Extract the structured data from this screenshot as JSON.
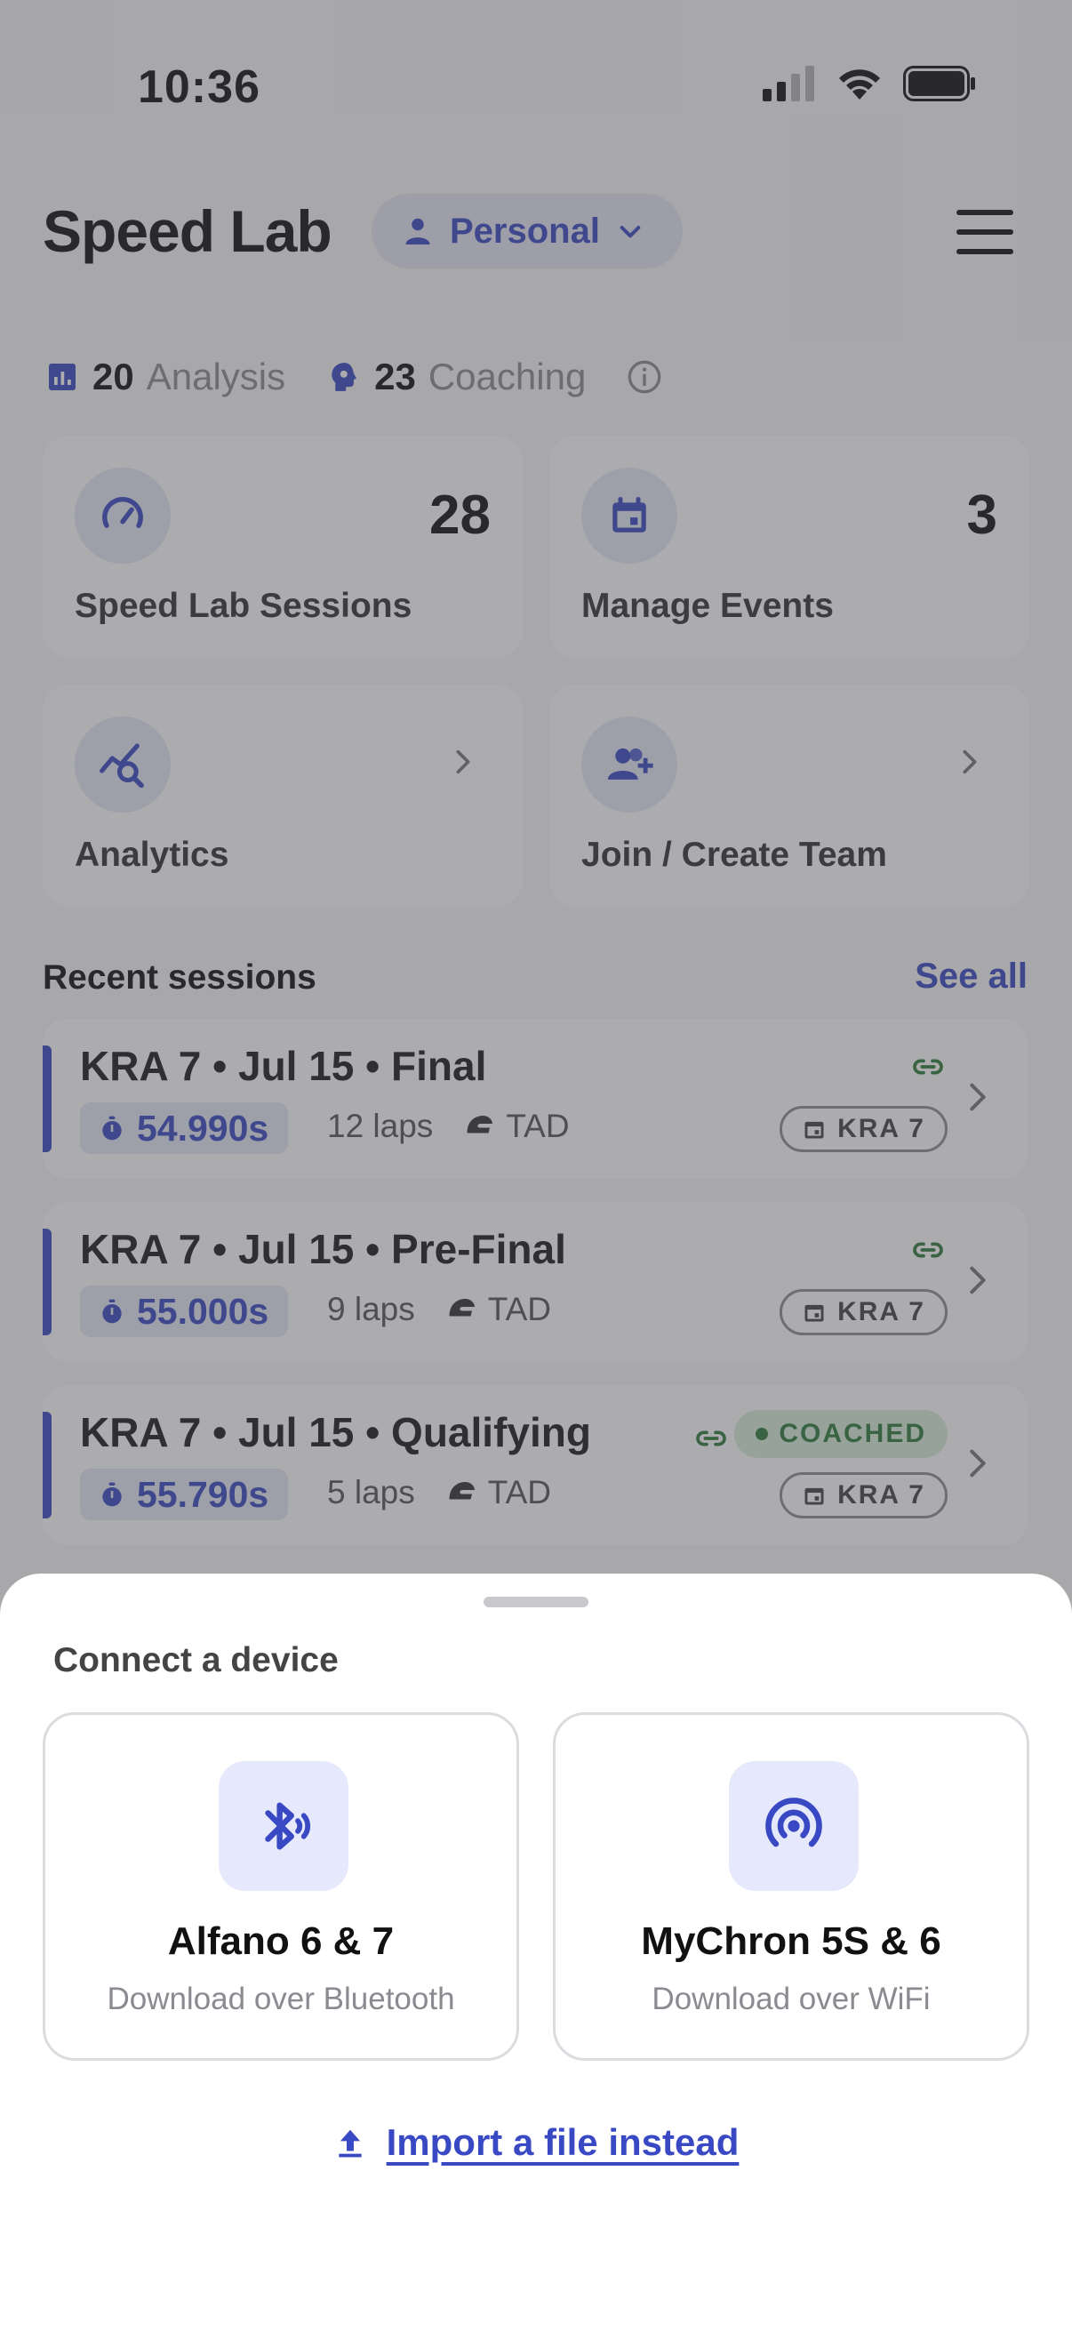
{
  "status_bar": {
    "time": "10:36"
  },
  "header": {
    "title": "Speed Lab",
    "mode": "Personal"
  },
  "counts": {
    "analysis_num": "20",
    "analysis_label": "Analysis",
    "coaching_num": "23",
    "coaching_label": "Coaching"
  },
  "cards": {
    "sessions": {
      "label": "Speed Lab Sessions",
      "count": "28"
    },
    "events": {
      "label": "Manage Events",
      "count": "3"
    },
    "analytics": {
      "label": "Analytics"
    },
    "team": {
      "label": "Join / Create Team"
    }
  },
  "recent": {
    "title": "Recent sessions",
    "see_all": "See all",
    "sessions": [
      {
        "title": "KRA 7 • Jul 15 • Final",
        "time": "54.990s",
        "laps": "12 laps",
        "class": "TAD",
        "track": "KRA 7"
      },
      {
        "title": "KRA 7 • Jul 15 • Pre-Final",
        "time": "55.000s",
        "laps": "9 laps",
        "class": "TAD",
        "track": "KRA 7"
      },
      {
        "title": "KRA 7 • Jul 15 • Qualifying",
        "time": "55.790s",
        "laps": "5 laps",
        "class": "TAD",
        "track": "KRA 7",
        "badge": "COACHED"
      }
    ]
  },
  "sheet": {
    "title": "Connect a device",
    "devices": [
      {
        "name": "Alfano 6 & 7",
        "subtitle": "Download over Bluetooth",
        "icon": "bluetooth-icon"
      },
      {
        "name": "MyChron 5S & 6",
        "subtitle": "Download over WiFi",
        "icon": "wifi-broadcast-icon"
      }
    ],
    "import_label": "Import a file instead"
  },
  "colors": {
    "accent": "#3949c4",
    "coached_bg": "#d9eedb",
    "coached_text": "#2f7a3b"
  }
}
